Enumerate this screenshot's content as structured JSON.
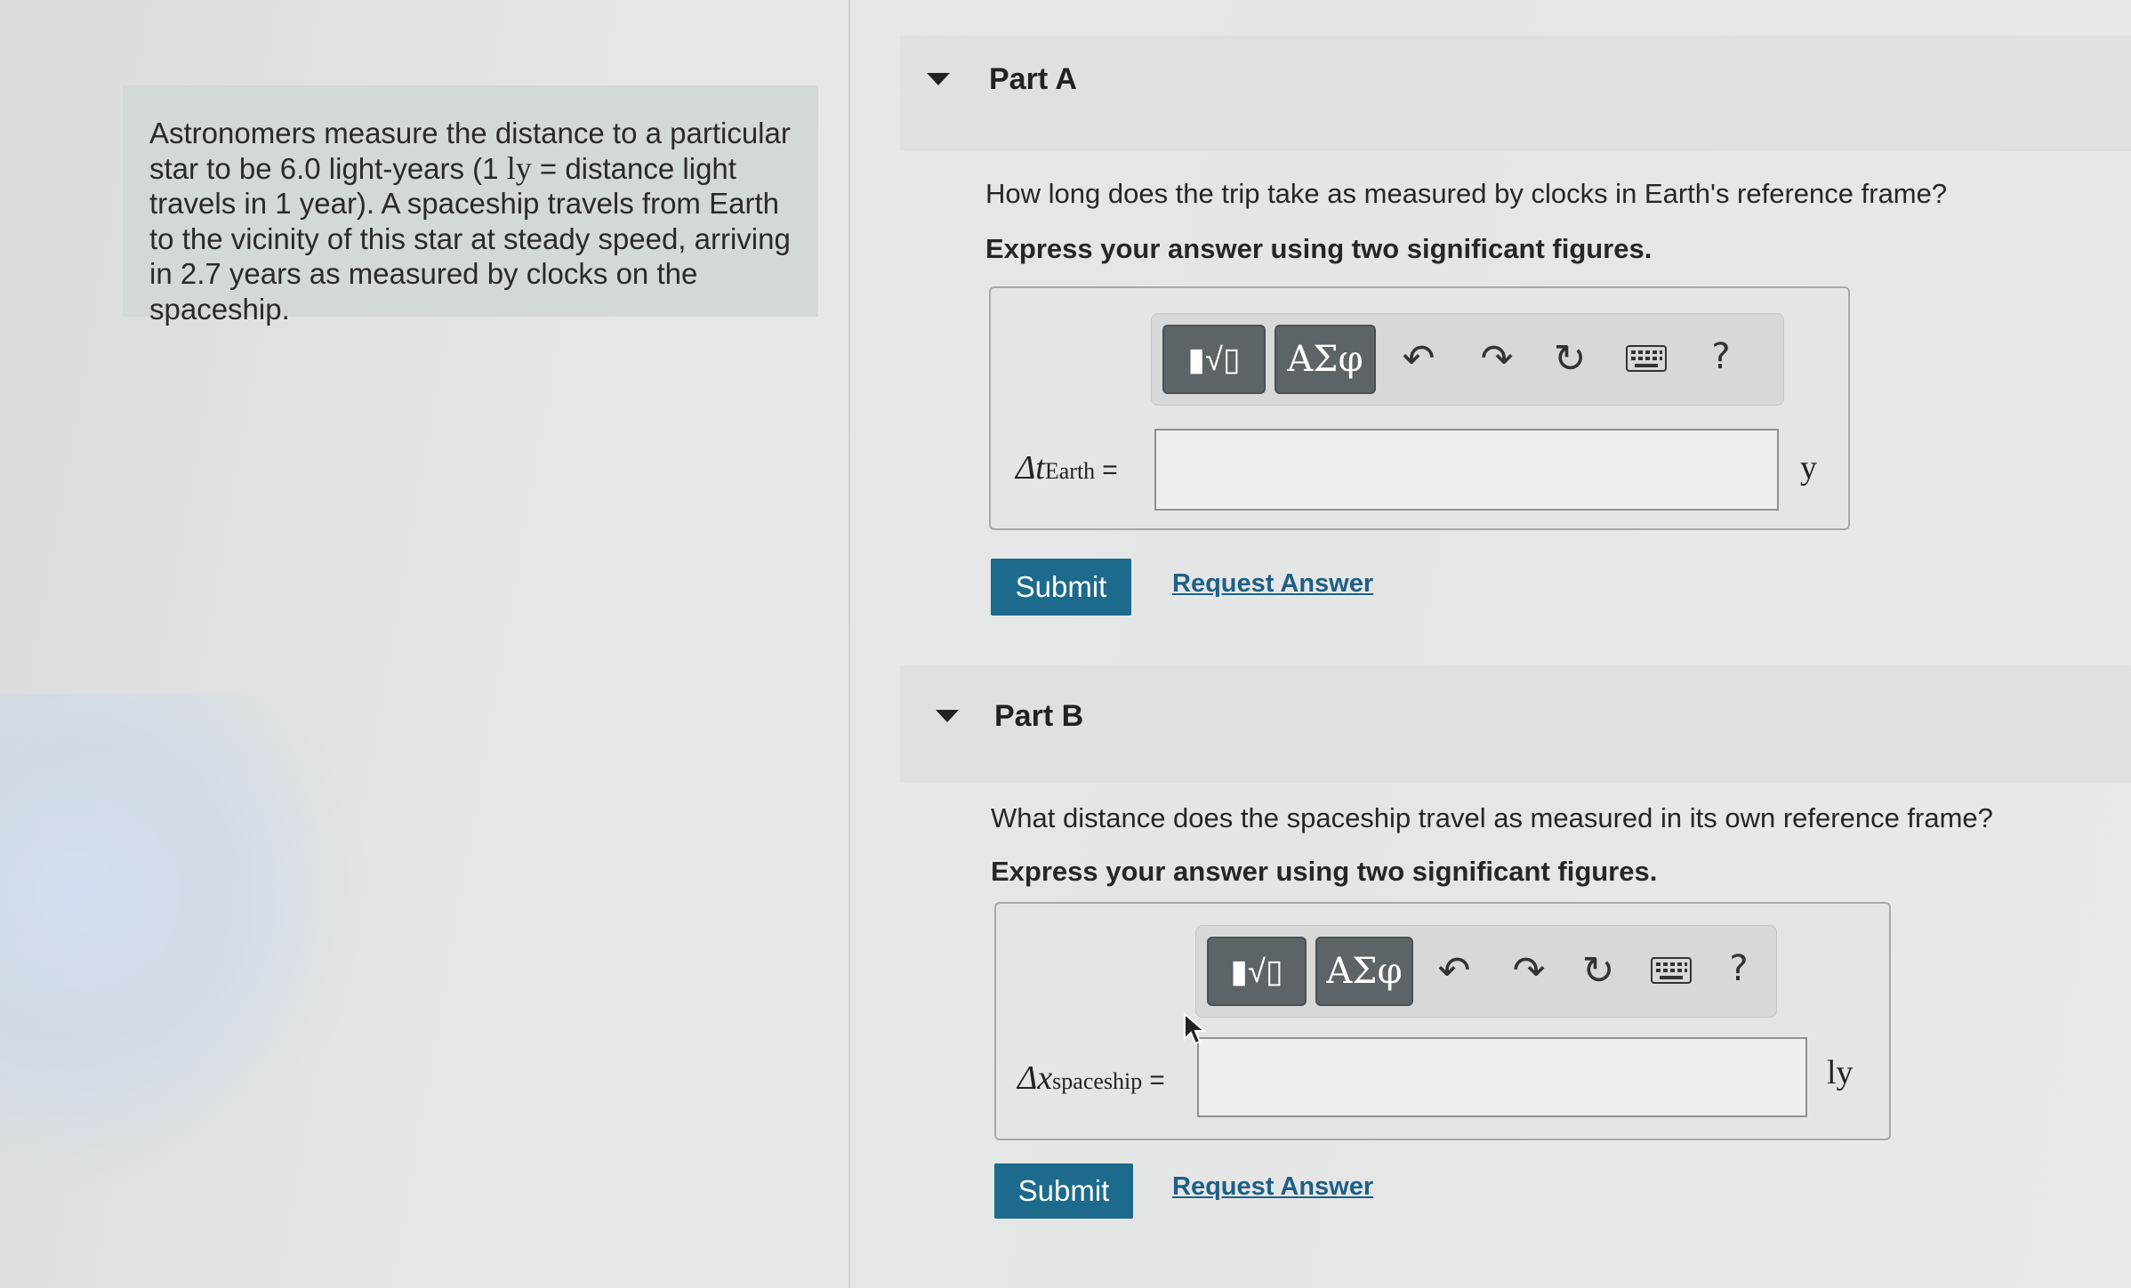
{
  "problem": {
    "text_before": "Astronomers measure the distance to a particular star to be 6.0 light-years (1 ",
    "unit_symbol": "ly",
    "text_after": " = distance light travels in 1 year). A spaceship travels from Earth to the vicinity of this star at steady speed, arriving in 2.7 years as measured by clocks on the spaceship."
  },
  "toolbar": {
    "templates_label": "▮√▯",
    "greek_label": "ΑΣφ",
    "undo_icon": "undo-icon",
    "redo_icon": "redo-icon",
    "reset_icon": "reset-icon",
    "keyboard_icon": "keyboard-icon",
    "help_label": "?"
  },
  "parts": [
    {
      "title": "Part A",
      "question": "How long does the trip take as measured by clocks in Earth's reference frame?",
      "instruction": "Express your answer using two significant figures.",
      "variable_symbol": "Δt",
      "variable_subscript": "Earth",
      "equals": "=",
      "input_value": "",
      "unit": "y",
      "submit_label": "Submit",
      "request_label": "Request Answer"
    },
    {
      "title": "Part B",
      "question": "What distance does the spaceship travel as measured in its own reference frame?",
      "instruction": "Express your answer using two significant figures.",
      "variable_symbol": "Δx",
      "variable_subscript": "spaceship",
      "equals": "=",
      "input_value": "",
      "unit": "ly",
      "submit_label": "Submit",
      "request_label": "Request Answer"
    }
  ],
  "colors": {
    "submit_bg": "#1c6a8c",
    "link": "#1e5f86",
    "toolbar_button": "#5d6467",
    "problem_bg": "#d2d9d7"
  }
}
